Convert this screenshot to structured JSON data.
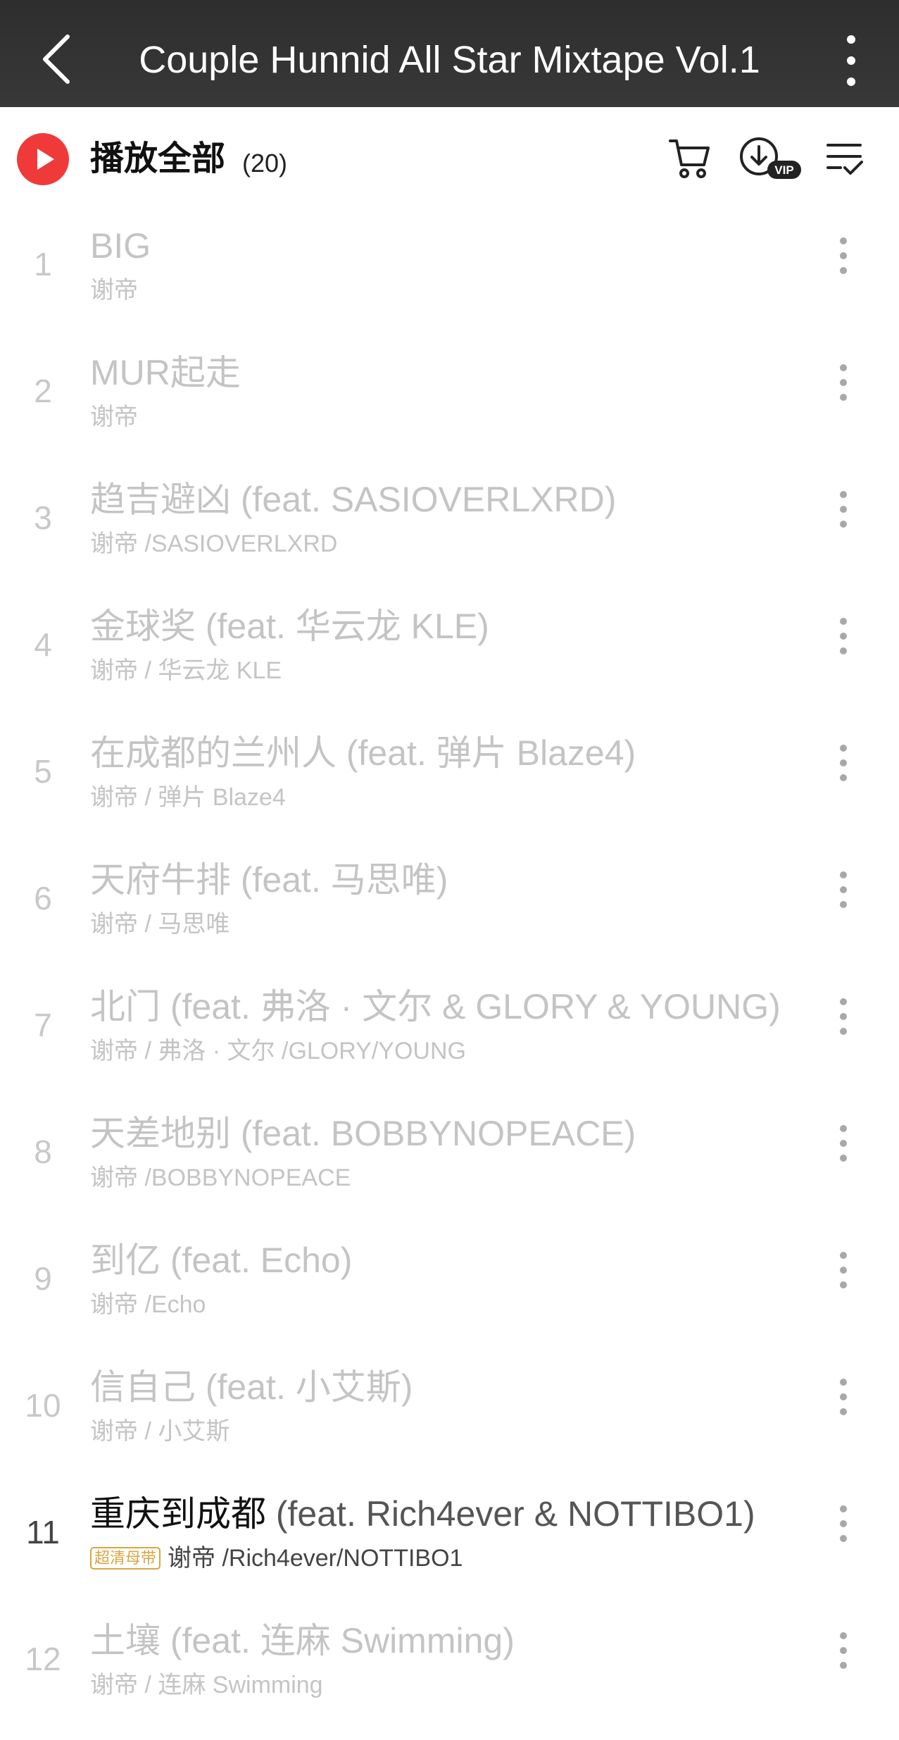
{
  "header": {
    "title": "Couple Hunnid All Star Mixtape Vol.1",
    "back_icon": "chevron-left-icon",
    "more_icon": "vertical-dots-icon"
  },
  "toolbar": {
    "play_all_label": "播放全部",
    "play_all_count": "(20)",
    "play_icon_color": "#f03a3a",
    "cart_icon": "shopping-cart-icon",
    "download_icon": "download-vip-icon",
    "download_badge": "VIP",
    "manage_icon": "list-check-icon"
  },
  "colors": {
    "accent": "#f03a3a",
    "disabled_text": "#c4c4c4",
    "quality_badge": "#d9a640"
  },
  "tracks": [
    {
      "index": "1",
      "title": "BIG",
      "feat": "",
      "artists": "谢帝"
    },
    {
      "index": "2",
      "title": "MUR起走",
      "feat": "",
      "artists": "谢帝"
    },
    {
      "index": "3",
      "title": "趋吉避凶",
      "feat": " (feat. SASIOVERLXRD)",
      "artists": "谢帝 /SASIOVERLXRD"
    },
    {
      "index": "4",
      "title": "金球奖",
      "feat": " (feat. 华云龙 KLE)",
      "artists": "谢帝 / 华云龙 KLE"
    },
    {
      "index": "5",
      "title": "在成都的兰州人",
      "feat": " (feat. 弹片 Blaze4)",
      "artists": "谢帝 / 弹片 Blaze4"
    },
    {
      "index": "6",
      "title": "天府牛排",
      "feat": " (feat. 马思唯)",
      "artists": "谢帝 / 马思唯"
    },
    {
      "index": "7",
      "title": "北门",
      "feat": " (feat. 弗洛 · 文尔 & GLORY & YOUNG)",
      "artists": "谢帝 / 弗洛 · 文尔 /GLORY/YOUNG"
    },
    {
      "index": "8",
      "title": "天差地别",
      "feat": " (feat. BOBBYNOPEACE)",
      "artists": "谢帝 /BOBBYNOPEACE"
    },
    {
      "index": "9",
      "title": "到亿",
      "feat": " (feat. Echo)",
      "artists": "谢帝 /Echo"
    },
    {
      "index": "10",
      "title": "信自己",
      "feat": " (feat. 小艾斯)",
      "artists": "谢帝 / 小艾斯"
    },
    {
      "index": "11",
      "title": "重庆到成都",
      "feat": " (feat. Rich4ever & NOTTIBO1)",
      "artists": "谢帝 /Rich4ever/NOTTIBO1",
      "badge": "超清母带",
      "available": true
    },
    {
      "index": "12",
      "title": "土壤",
      "feat": " (feat. 连麻 Swimming)",
      "artists": "谢帝 / 连麻 Swimming"
    }
  ]
}
